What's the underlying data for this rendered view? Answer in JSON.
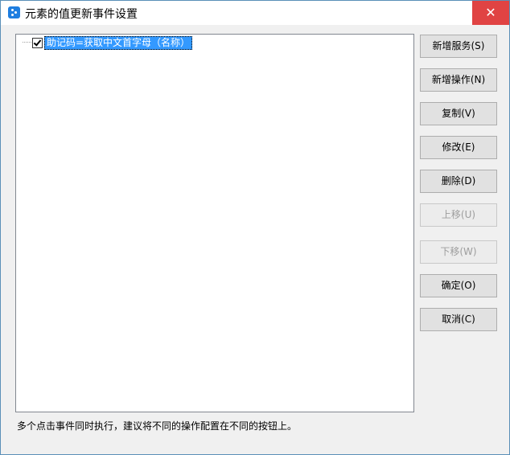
{
  "window": {
    "title": "元素的值更新事件设置",
    "close_glyph": "✕"
  },
  "tree": {
    "items": [
      {
        "label": "助记码=获取中文首字母（名称）",
        "checked": true
      }
    ]
  },
  "buttons": {
    "add_service": "新增服务(S)",
    "add_operation": "新增操作(N)",
    "copy": "复制(V)",
    "modify": "修改(E)",
    "delete": "删除(D)",
    "move_up": "上移(U)",
    "move_down": "下移(W)",
    "ok": "确定(O)",
    "cancel": "取消(C)"
  },
  "hint": "多个点击事件同时执行，建议将不同的操作配置在不同的按钮上。"
}
